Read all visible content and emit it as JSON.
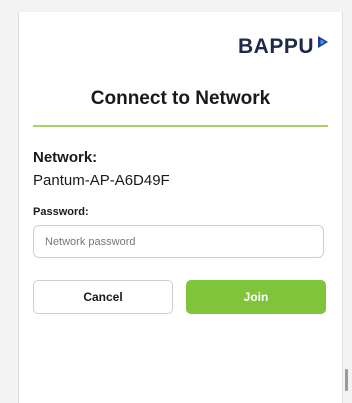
{
  "brand": {
    "logo_text": "BAPPU",
    "logo_mark_color": "#1f3a8a",
    "logo_mark_accent": "#3aa0e6"
  },
  "dialog": {
    "title": "Connect to Network",
    "network_label": "Network:",
    "network_name": "Pantum-AP-A6D49F",
    "password_label": "Password:",
    "password_value": "",
    "password_placeholder": "Network password",
    "cancel_label": "Cancel",
    "join_label": "Join"
  },
  "colors": {
    "accent": "#7fc43a",
    "divider": "#a9cf66"
  }
}
